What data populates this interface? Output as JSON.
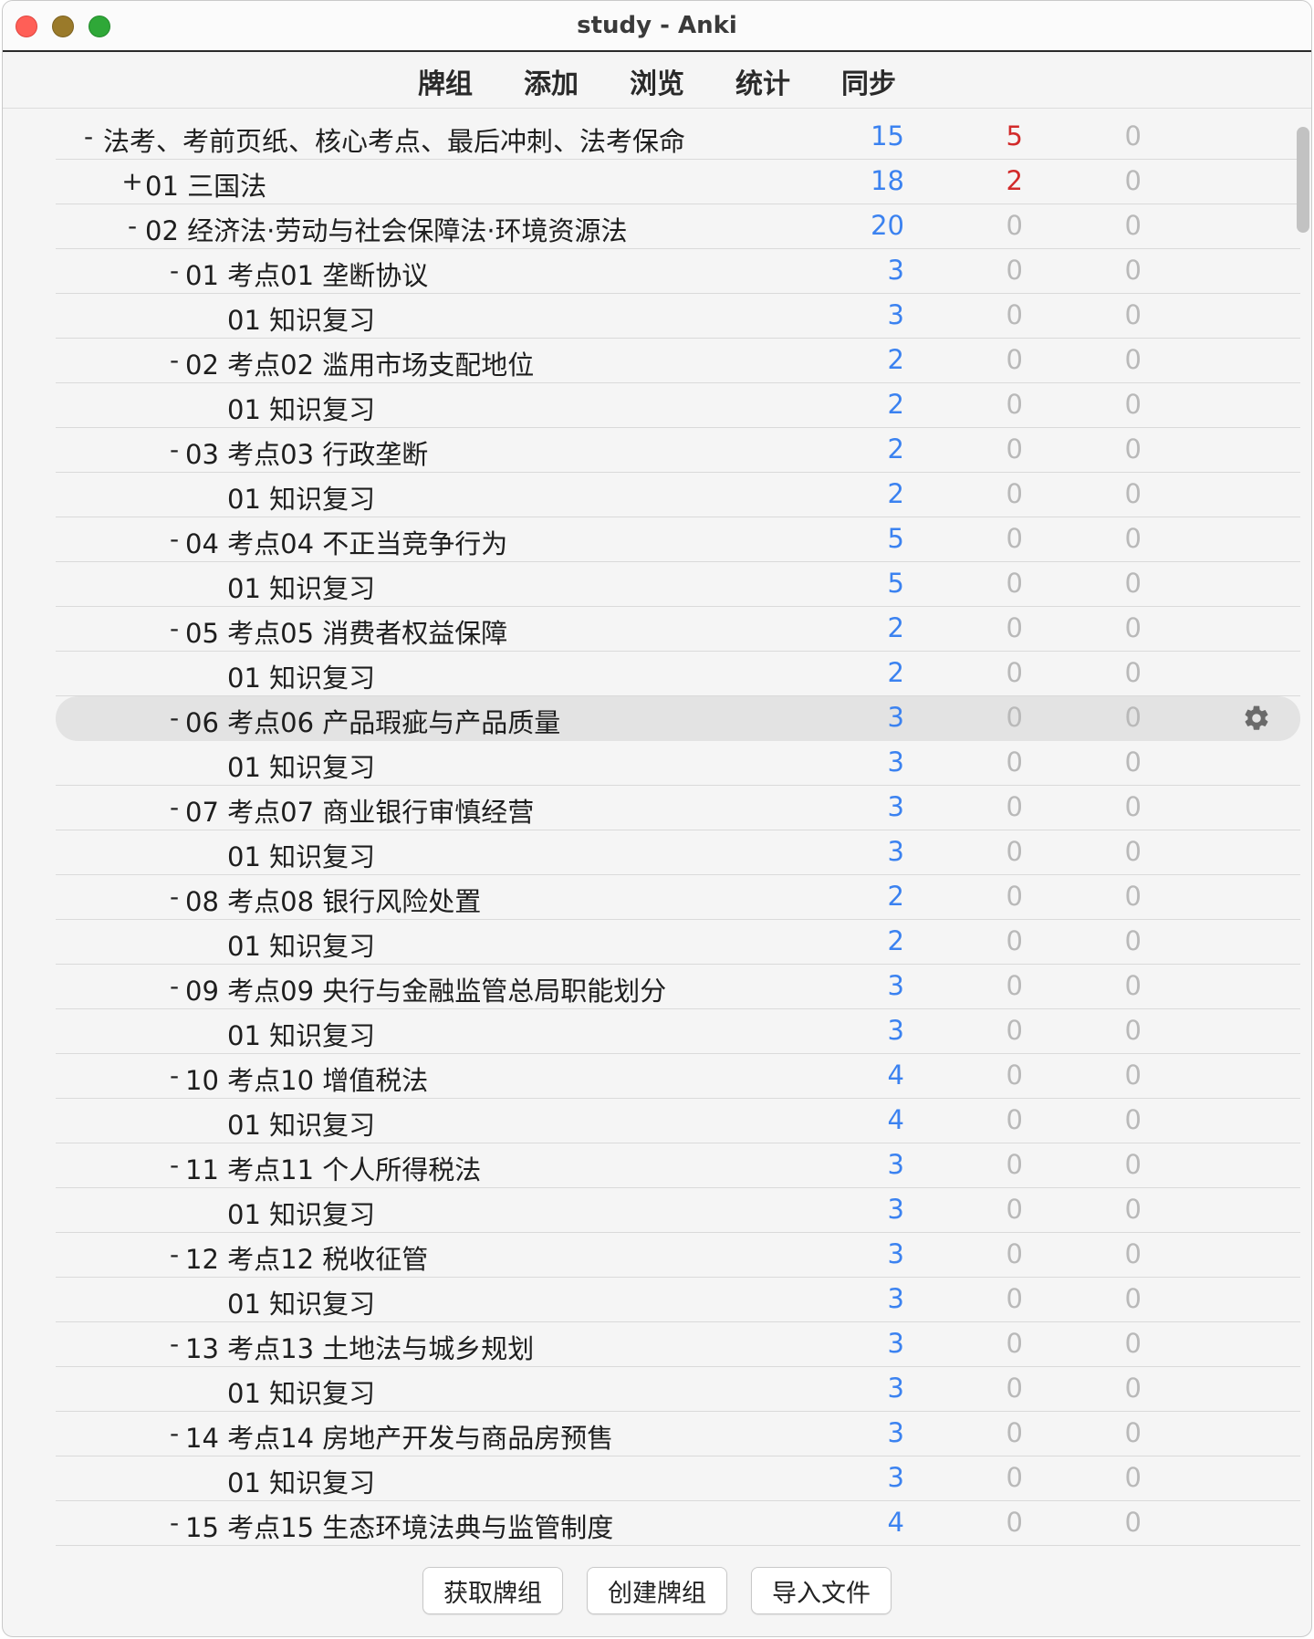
{
  "window": {
    "title": "study - Anki"
  },
  "toolbar": {
    "items": [
      {
        "label": "牌组"
      },
      {
        "label": "添加"
      },
      {
        "label": "浏览"
      },
      {
        "label": "统计"
      },
      {
        "label": "同步"
      }
    ]
  },
  "colors": {
    "due": "#3b82f0",
    "learn": "#d22a2a",
    "zero": "#b9b9b9",
    "gear": "#6a6a6a"
  },
  "decks": [
    {
      "toggle": "-",
      "level": 0,
      "name": "法考、考前页纸、核心考点、最后冲刺、法考保命",
      "due": "15",
      "learn": "5",
      "review": "0"
    },
    {
      "toggle": "+",
      "level": 1,
      "name": "01 三国法",
      "due": "18",
      "learn": "2",
      "review": "0"
    },
    {
      "toggle": "-",
      "level": 1,
      "name": "02 经济法·劳动与社会保障法·环境资源法",
      "due": "20",
      "learn": "0",
      "review": "0"
    },
    {
      "toggle": "-",
      "level": 2,
      "name": "01 考点01 垄断协议",
      "due": "3",
      "learn": "0",
      "review": "0"
    },
    {
      "toggle": "",
      "level": 3,
      "name": "01 知识复习",
      "due": "3",
      "learn": "0",
      "review": "0"
    },
    {
      "toggle": "-",
      "level": 2,
      "name": "02 考点02 滥用市场支配地位",
      "due": "2",
      "learn": "0",
      "review": "0"
    },
    {
      "toggle": "",
      "level": 3,
      "name": "01 知识复习",
      "due": "2",
      "learn": "0",
      "review": "0"
    },
    {
      "toggle": "-",
      "level": 2,
      "name": "03 考点03 行政垄断",
      "due": "2",
      "learn": "0",
      "review": "0"
    },
    {
      "toggle": "",
      "level": 3,
      "name": "01 知识复习",
      "due": "2",
      "learn": "0",
      "review": "0"
    },
    {
      "toggle": "-",
      "level": 2,
      "name": "04 考点04 不正当竞争行为",
      "due": "5",
      "learn": "0",
      "review": "0"
    },
    {
      "toggle": "",
      "level": 3,
      "name": "01 知识复习",
      "due": "5",
      "learn": "0",
      "review": "0"
    },
    {
      "toggle": "-",
      "level": 2,
      "name": "05 考点05 消费者权益保障",
      "due": "2",
      "learn": "0",
      "review": "0"
    },
    {
      "toggle": "",
      "level": 3,
      "name": "01 知识复习",
      "due": "2",
      "learn": "0",
      "review": "0"
    },
    {
      "toggle": "-",
      "level": 2,
      "name": "06 考点06 产品瑕疵与产品质量",
      "due": "3",
      "learn": "0",
      "review": "0",
      "highlighted": true
    },
    {
      "toggle": "",
      "level": 3,
      "name": "01 知识复习",
      "due": "3",
      "learn": "0",
      "review": "0"
    },
    {
      "toggle": "-",
      "level": 2,
      "name": "07 考点07 商业银行审慎经营",
      "due": "3",
      "learn": "0",
      "review": "0"
    },
    {
      "toggle": "",
      "level": 3,
      "name": "01 知识复习",
      "due": "3",
      "learn": "0",
      "review": "0"
    },
    {
      "toggle": "-",
      "level": 2,
      "name": "08 考点08 银行风险处置",
      "due": "2",
      "learn": "0",
      "review": "0"
    },
    {
      "toggle": "",
      "level": 3,
      "name": "01 知识复习",
      "due": "2",
      "learn": "0",
      "review": "0"
    },
    {
      "toggle": "-",
      "level": 2,
      "name": "09 考点09 央行与金融监管总局职能划分",
      "due": "3",
      "learn": "0",
      "review": "0"
    },
    {
      "toggle": "",
      "level": 3,
      "name": "01 知识复习",
      "due": "3",
      "learn": "0",
      "review": "0"
    },
    {
      "toggle": "-",
      "level": 2,
      "name": "10 考点10 增值税法",
      "due": "4",
      "learn": "0",
      "review": "0"
    },
    {
      "toggle": "",
      "level": 3,
      "name": "01 知识复习",
      "due": "4",
      "learn": "0",
      "review": "0"
    },
    {
      "toggle": "-",
      "level": 2,
      "name": "11 考点11 个人所得税法",
      "due": "3",
      "learn": "0",
      "review": "0"
    },
    {
      "toggle": "",
      "level": 3,
      "name": "01 知识复习",
      "due": "3",
      "learn": "0",
      "review": "0"
    },
    {
      "toggle": "-",
      "level": 2,
      "name": "12 考点12 税收征管",
      "due": "3",
      "learn": "0",
      "review": "0"
    },
    {
      "toggle": "",
      "level": 3,
      "name": "01 知识复习",
      "due": "3",
      "learn": "0",
      "review": "0"
    },
    {
      "toggle": "-",
      "level": 2,
      "name": "13 考点13 土地法与城乡规划",
      "due": "3",
      "learn": "0",
      "review": "0"
    },
    {
      "toggle": "",
      "level": 3,
      "name": "01 知识复习",
      "due": "3",
      "learn": "0",
      "review": "0"
    },
    {
      "toggle": "-",
      "level": 2,
      "name": "14 考点14 房地产开发与商品房预售",
      "due": "3",
      "learn": "0",
      "review": "0"
    },
    {
      "toggle": "",
      "level": 3,
      "name": "01 知识复习",
      "due": "3",
      "learn": "0",
      "review": "0"
    },
    {
      "toggle": "-",
      "level": 2,
      "name": "15 考点15 生态环境法典与监管制度",
      "due": "4",
      "learn": "0",
      "review": "0"
    }
  ],
  "bottom_buttons": [
    {
      "label": "获取牌组"
    },
    {
      "label": "创建牌组"
    },
    {
      "label": "导入文件"
    }
  ]
}
